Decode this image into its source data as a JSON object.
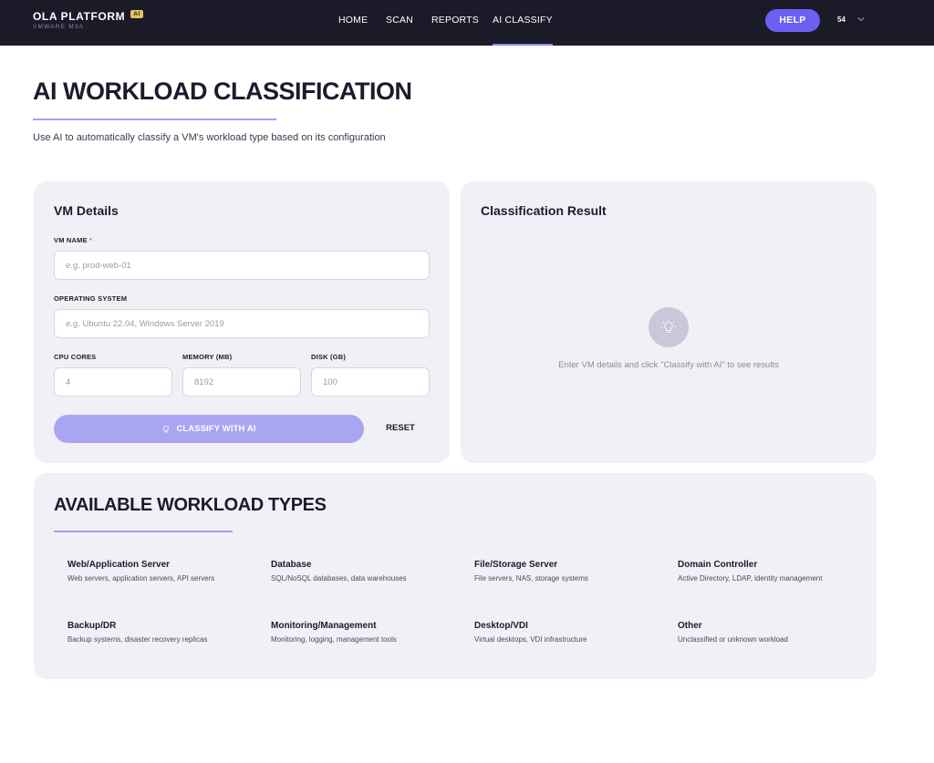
{
  "brand": {
    "name": "OLA PLATFORM",
    "badge": "AI",
    "subtitle": "VMWARE M3A"
  },
  "nav": {
    "items": [
      {
        "label": "HOME"
      },
      {
        "label": "SCAN"
      },
      {
        "label": "REPORTS"
      },
      {
        "label": "AI CLASSIFY",
        "active": true
      }
    ],
    "help_label": "HELP",
    "user_initials": "54"
  },
  "page": {
    "title": "AI WORKLOAD CLASSIFICATION",
    "description": "Use AI to automatically classify a VM's workload type based on its configuration"
  },
  "vm_details": {
    "title": "VM Details",
    "vm_name": {
      "label": "VM NAME",
      "required_mark": "*",
      "placeholder": "e.g. prod-web-01"
    },
    "os": {
      "label": "OPERATING SYSTEM",
      "placeholder": "e.g. Ubuntu 22.04, Windows Server 2019"
    },
    "cpu": {
      "label": "CPU CORES",
      "placeholder": "4"
    },
    "memory": {
      "label": "MEMORY (MB)",
      "placeholder": "8192"
    },
    "disk": {
      "label": "DISK (GB)",
      "placeholder": "100"
    },
    "classify_label": "CLASSIFY WITH AI",
    "reset_label": "RESET"
  },
  "result": {
    "title": "Classification Result",
    "empty_message": "Enter VM details and click \"Classify with AI\" to see results"
  },
  "workload_types": {
    "title": "AVAILABLE WORKLOAD TYPES",
    "items": [
      {
        "name": "Web/Application Server",
        "desc": "Web servers, application servers, API servers"
      },
      {
        "name": "Database",
        "desc": "SQL/NoSQL databases, data warehouses"
      },
      {
        "name": "File/Storage Server",
        "desc": "File servers, NAS, storage systems"
      },
      {
        "name": "Domain Controller",
        "desc": "Active Directory, LDAP, identity management"
      },
      {
        "name": "Backup/DR",
        "desc": "Backup systems, disaster recovery replicas"
      },
      {
        "name": "Monitoring/Management",
        "desc": "Monitoring, logging, management tools"
      },
      {
        "name": "Desktop/VDI",
        "desc": "Virtual desktops, VDI infrastructure"
      },
      {
        "name": "Other",
        "desc": "Unclassified or unknown workload"
      }
    ]
  },
  "colors": {
    "topbar": "#1a1a29",
    "accent": "#6d5ff2",
    "accent_light": "#aaa5f3",
    "card_bg": "#f0f0f6"
  },
  "icons": {
    "lightbulb": "lightbulb-icon",
    "chevron": "chevron-down-icon"
  }
}
